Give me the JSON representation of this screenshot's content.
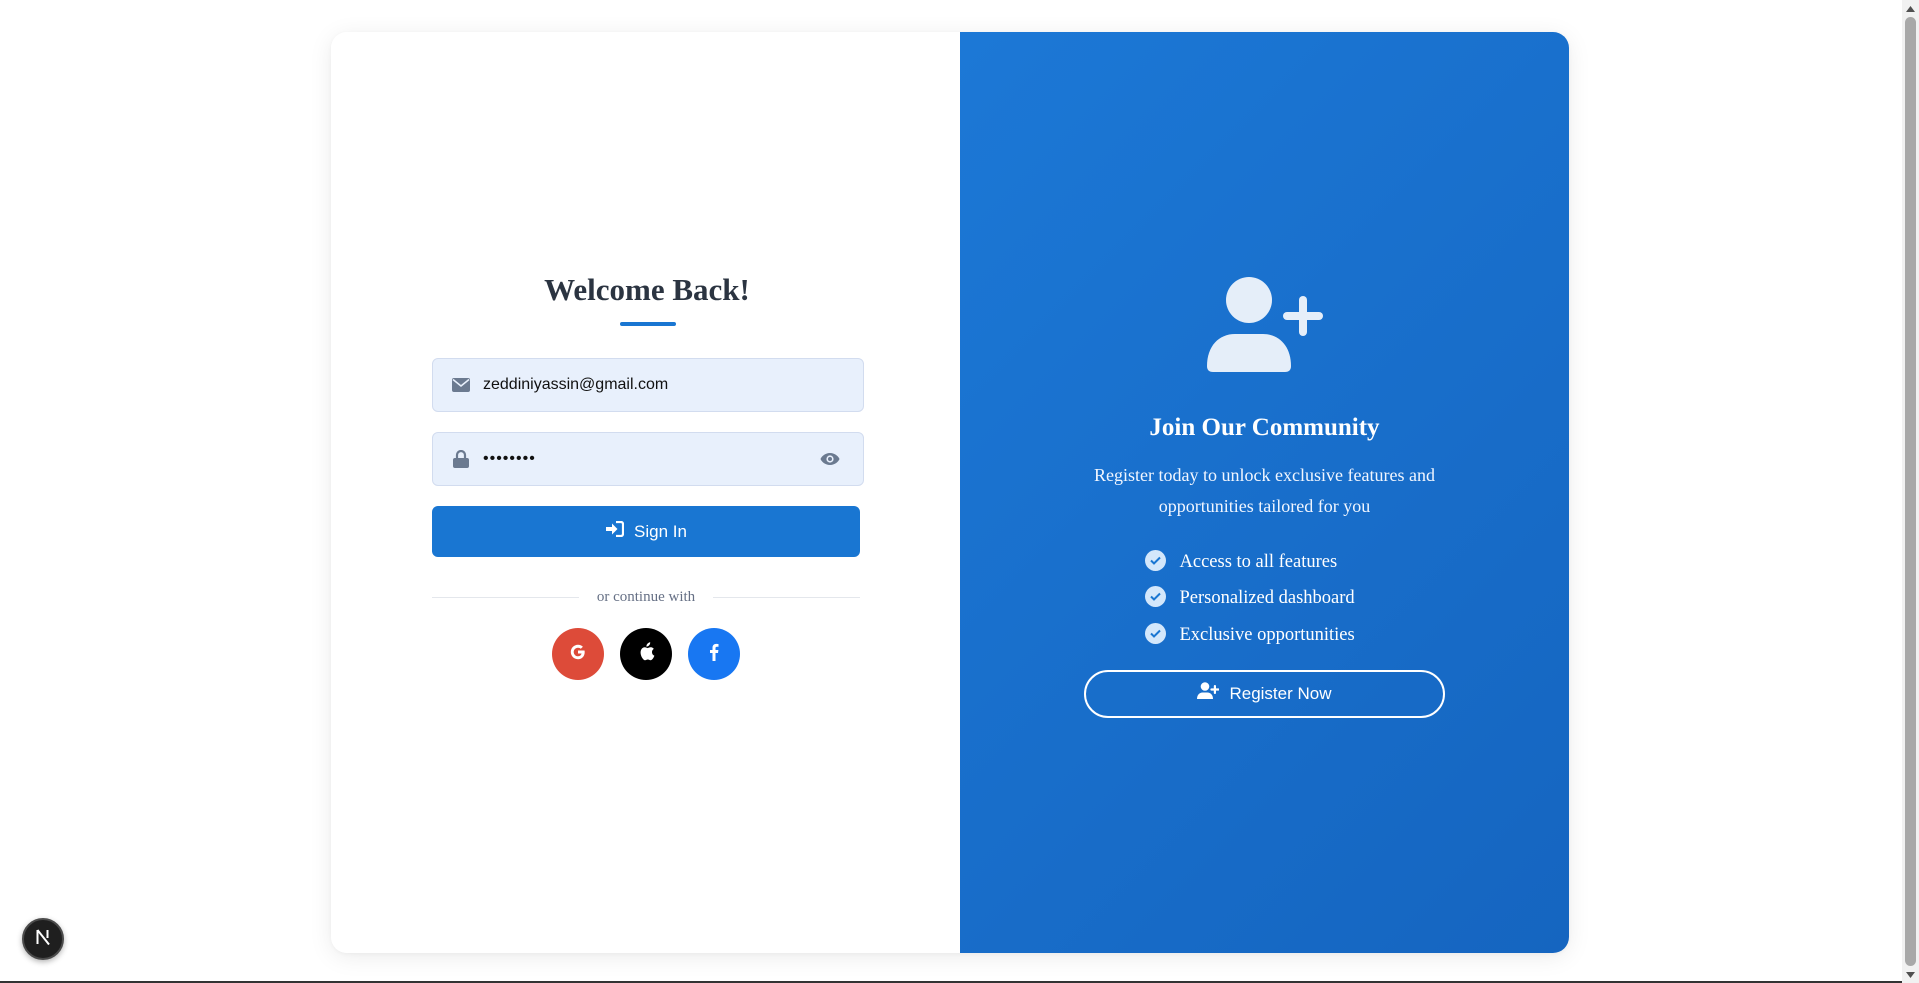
{
  "login": {
    "title": "Welcome Back!",
    "email_value": "zeddiniyassin@gmail.com",
    "password_value": "••••••••",
    "signin_label": "Sign In",
    "divider_text": "or continue with",
    "social": [
      "google-icon",
      "apple-icon",
      "facebook-icon"
    ]
  },
  "register_panel": {
    "title": "Join Our Community",
    "subtitle": "Register today to unlock exclusive features and opportunities tailored for you",
    "features": [
      "Access to all features",
      "Personalized dashboard",
      "Exclusive opportunities"
    ],
    "button_label": "Register Now"
  },
  "colors": {
    "primary": "#1976d2",
    "google": "#dd4b39",
    "apple": "#000000",
    "facebook": "#1877f2",
    "input_bg": "#e8f0fc"
  }
}
